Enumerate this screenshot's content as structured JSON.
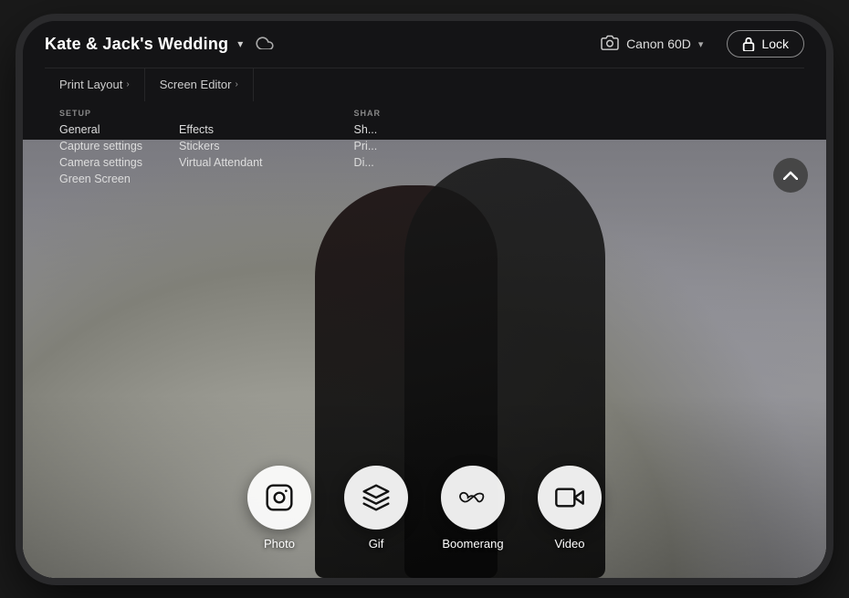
{
  "header": {
    "title": "Kate & Jack's Wedding",
    "chevron": "▾",
    "cloud_icon": "☁",
    "camera_label": "Canon 60D",
    "camera_chevron": "▾",
    "lock_label": "Lock"
  },
  "nav": {
    "items": [
      {
        "label": "Print Layout",
        "arrow": "›"
      },
      {
        "label": "Screen Editor",
        "arrow": "›"
      }
    ]
  },
  "setup_menu": {
    "label": "SETUP",
    "items": [
      "General",
      "Capture settings",
      "Camera settings",
      "Green Screen"
    ]
  },
  "effects_menu": {
    "items": [
      "Effects",
      "Stickers",
      "Virtual Attendant"
    ]
  },
  "share_menu": {
    "label": "SHAR",
    "items": [
      "Sh...",
      "Pri...",
      "Di..."
    ]
  },
  "scroll_up": "∧",
  "modes": [
    {
      "id": "photo",
      "label": "Photo",
      "icon": "instagram"
    },
    {
      "id": "gif",
      "label": "Gif",
      "icon": "layers"
    },
    {
      "id": "boomerang",
      "label": "Boomerang",
      "icon": "infinity"
    },
    {
      "id": "video",
      "label": "Video",
      "icon": "video"
    }
  ]
}
